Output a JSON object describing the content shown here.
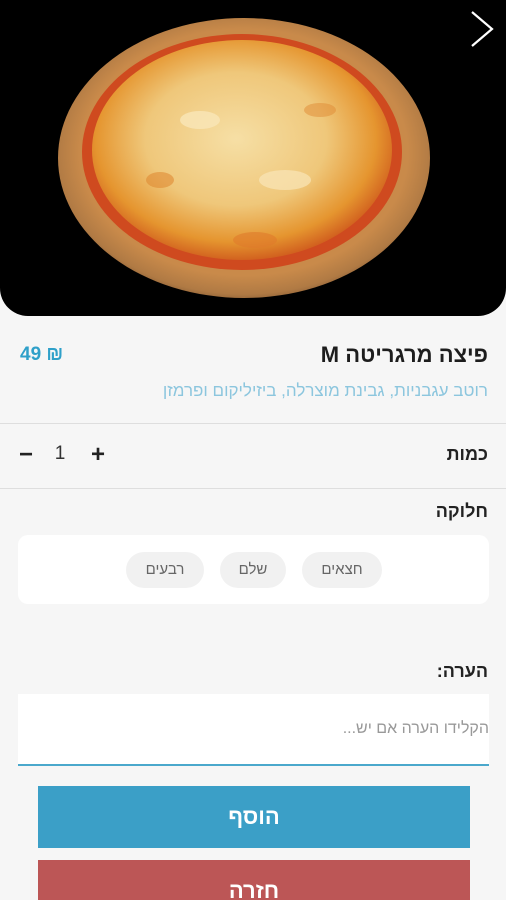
{
  "item": {
    "title": "פיצה מרגריטה M",
    "price": "49 ₪",
    "description": "רוטב עגבניות, גבינת מוצרלה, ביזיליקום ופרמזן"
  },
  "quantity": {
    "label": "כמות",
    "minus": "−",
    "plus": "+",
    "value": "1"
  },
  "division": {
    "label": "חלוקה",
    "options": [
      "חצאים",
      "שלם",
      "רבעים"
    ]
  },
  "note": {
    "label": "הערה:",
    "placeholder": "הקלידו הערה אם יש..."
  },
  "actions": {
    "add_label": "הוסף",
    "back_label": "חזרה"
  },
  "colors": {
    "accent": "#3b9fc7",
    "danger": "#bc5656",
    "price": "#2fa0c9"
  },
  "icons": {
    "back": "chevron-right-icon",
    "image": "pizza-photo"
  }
}
